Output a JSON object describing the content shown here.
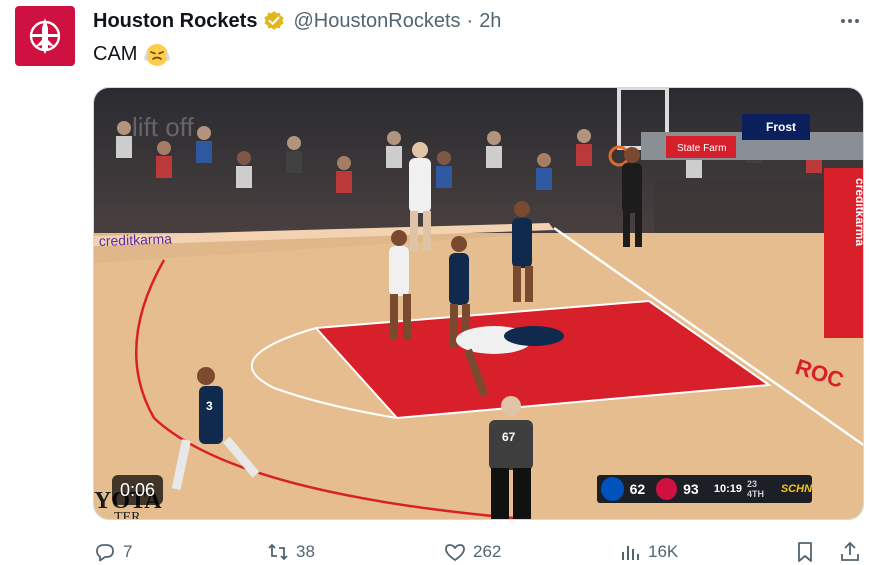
{
  "account": {
    "display_name": "Houston Rockets",
    "handle": "@HoustonRockets",
    "separator": "·",
    "time": "2h",
    "avatar_icon": "rockets-logo-icon",
    "brand_color": "#ce1141",
    "verified_color": "#e2b719"
  },
  "tweet": {
    "text": "CAM",
    "emoji_icon": "face-with-steam-icon"
  },
  "video": {
    "elapsed": "0:06",
    "scorebug": {
      "away_score": "62",
      "home_score": "93",
      "clock": "10:19",
      "detail": "23 4TH",
      "network": "SCHN"
    },
    "court_text": {
      "baseline_ad": "creditkarma",
      "stand_ad": "creditkarma",
      "state_farm": "State Farm",
      "frost": "Frost",
      "ref_number": "67",
      "jersey_number": "3",
      "watermark": "lift off",
      "arena_text_1": "YOTA",
      "arena_text_2": "TER",
      "end_text": "ROC"
    }
  },
  "actions": {
    "replies": "7",
    "reposts": "38",
    "likes": "262",
    "views": "16K"
  }
}
